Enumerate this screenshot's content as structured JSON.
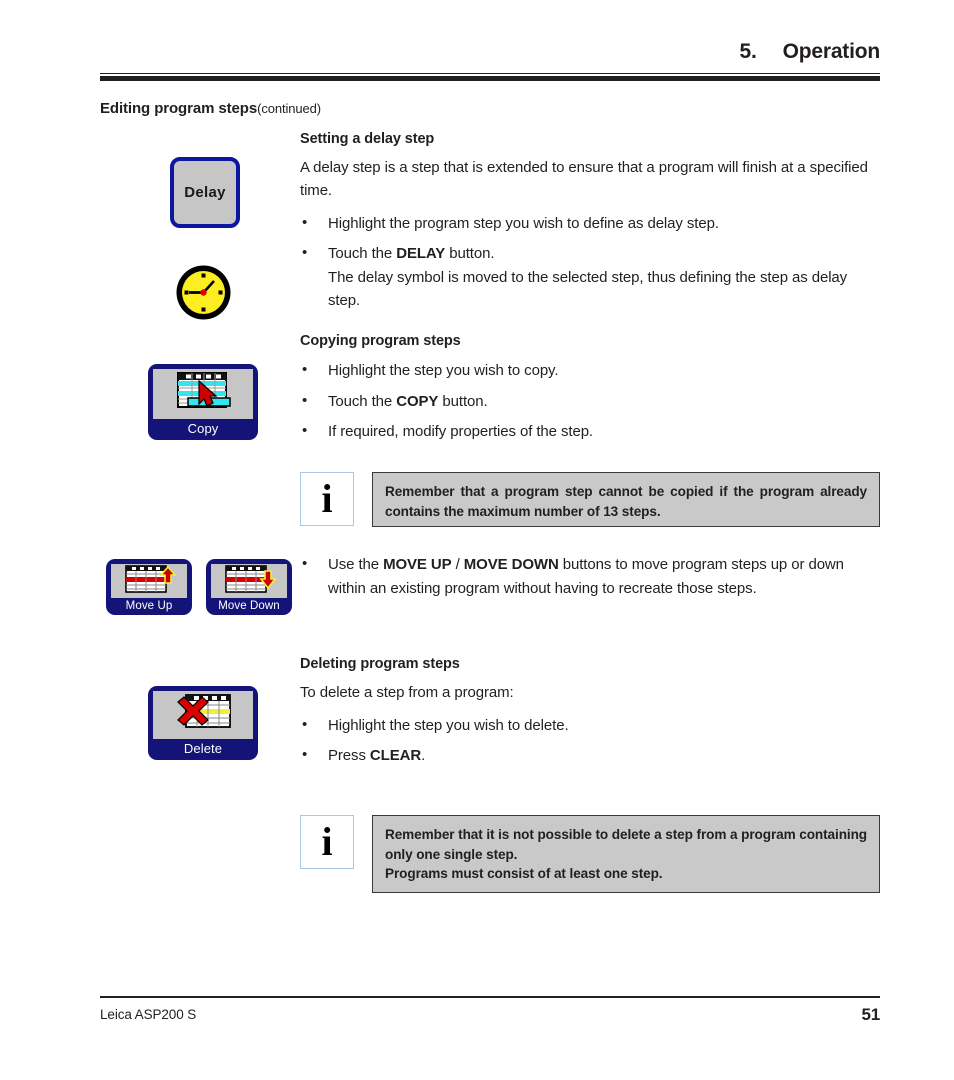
{
  "header": {
    "chapter_number": "5.",
    "title": "Operation"
  },
  "section": {
    "title": "Editing program steps",
    "continued": "(continued)"
  },
  "blocks": {
    "delay": {
      "heading": "Setting a delay step",
      "paragraph": "A delay step is a step that is extended to ensure that a program will finish at a specified time.",
      "bullet1": "Highlight the program step you wish to define as delay step.",
      "bullet2_prefix": "Touch the ",
      "bullet2_bold": "DELAY",
      "bullet2_suffix": " button.",
      "bullet2_line2": "The delay symbol is moved to the selected step, thus defining the step as delay step."
    },
    "copy": {
      "heading": "Copying program steps",
      "bullet1": "Highlight the step you wish to copy.",
      "bullet2_prefix": "Touch the ",
      "bullet2_bold": "COPY",
      "bullet2_suffix": " button.",
      "bullet3": "If required, modify properties of the step."
    },
    "move": {
      "bullet_prefix": "Use the ",
      "bullet_bold1": "MOVE UP",
      "bullet_sep": " / ",
      "bullet_bold2": "MOVE DOWN",
      "bullet_suffix": " buttons to move program steps up or down within an existing program without having to recreate those steps."
    },
    "delete": {
      "heading": "Deleting program steps",
      "paragraph": "To delete a step from a program:",
      "bullet1": "Highlight the step you wish to delete.",
      "bullet2_prefix": "Press ",
      "bullet2_bold": "CLEAR",
      "bullet2_suffix": "."
    }
  },
  "notes": {
    "note1": {
      "icon_glyph": "i",
      "text": "Remember that a program step cannot be copied if the program already contains the maximum number of 13 steps."
    },
    "note2": {
      "icon_glyph": "i",
      "line1": "Remember that it is not possible to delete a step from a program containing only one single step.",
      "line2": "Programs must consist of at least one step."
    }
  },
  "buttons": {
    "delay": {
      "label": "Delay"
    },
    "copy": {
      "label": "Copy"
    },
    "move_up": {
      "label": "Move Up"
    },
    "move_down": {
      "label": "Move Down"
    },
    "delete": {
      "label": "Delete"
    }
  },
  "icons": {
    "clock": "clock-delay-symbol",
    "copy_table": "copy-table-arrow-icon",
    "move_up_table": "move-up-table-arrow-icon",
    "move_down_table": "move-down-table-arrow-icon",
    "delete_table": "delete-table-cross-icon"
  },
  "footer": {
    "product": "Leica ASP200 S",
    "page_number": "51"
  },
  "colors": {
    "ink": "#231f20",
    "button_blue": "#141478",
    "delay_border_blue": "#0d16a0",
    "button_face_gray": "#c6c6c6",
    "note_bg_gray": "#c9c9c9",
    "note_border": "#3a3a3a",
    "note_icon_border": "#a8c8e8",
    "clock_yellow": "#fcee21",
    "accent_red": "#cc0000",
    "accent_cyan": "#33e5f0",
    "accent_yellow": "#f2ef3a"
  }
}
